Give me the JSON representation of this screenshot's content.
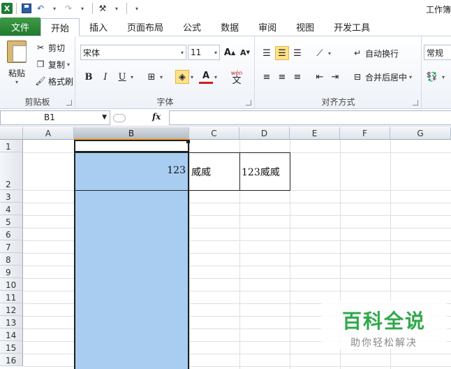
{
  "app": {
    "title": "工作簿"
  },
  "tabs": [
    {
      "label": "文件"
    },
    {
      "label": "开始"
    },
    {
      "label": "插入"
    },
    {
      "label": "页面布局"
    },
    {
      "label": "公式"
    },
    {
      "label": "数据"
    },
    {
      "label": "审阅"
    },
    {
      "label": "视图"
    },
    {
      "label": "开发工具"
    }
  ],
  "clipboard": {
    "paste": "粘贴",
    "cut": "剪切",
    "copy": "复制",
    "format_painter": "格式刷",
    "group": "剪贴板"
  },
  "font": {
    "name": "宋体",
    "size": "11",
    "group": "字体",
    "wen": "wén",
    "wen_char": "文"
  },
  "alignment": {
    "wrap": "自动换行",
    "merge": "合并后居中",
    "group": "对齐方式"
  },
  "number": {
    "format": "常规"
  },
  "formula_bar": {
    "name_box": "B1",
    "fx": "fx",
    "content": ""
  },
  "columns": [
    "A",
    "B",
    "C",
    "D",
    "E",
    "F",
    "G"
  ],
  "rows": [
    "1",
    "2",
    "3",
    "4",
    "5",
    "6",
    "7",
    "8",
    "9",
    "10",
    "11",
    "12",
    "13",
    "14",
    "15",
    "16"
  ],
  "cells": {
    "B2": "123",
    "C2": "威威",
    "D2": "123威威"
  },
  "watermark": {
    "title": "百科全说",
    "subtitle": "助你轻松解决"
  },
  "colors": {
    "file_tab": "#217a2e",
    "selection": "#a8cdf0",
    "watermark": "#2ea84a"
  }
}
